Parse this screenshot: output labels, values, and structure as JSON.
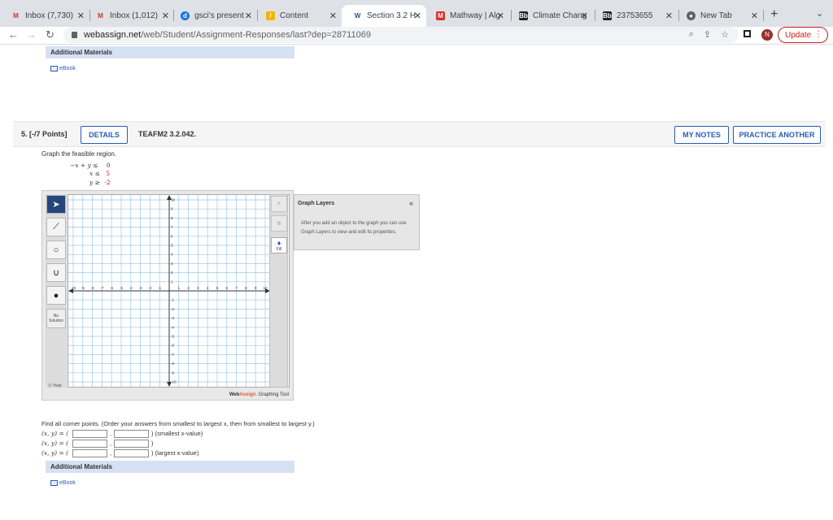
{
  "browser": {
    "tabs": [
      {
        "title": "Inbox (7,730)",
        "icon": "gmail-icon"
      },
      {
        "title": "Inbox (1,012)",
        "icon": "gmail-icon"
      },
      {
        "title": "gsci's present",
        "icon": "gsci-icon"
      },
      {
        "title": "Content",
        "icon": "content-icon"
      },
      {
        "title": "Section 3.2 H",
        "icon": "webassign-icon"
      },
      {
        "title": "Mathway | Alg",
        "icon": "mathway-icon"
      },
      {
        "title": "Climate Chang",
        "icon": "blackboard-icon"
      },
      {
        "title": "23753655",
        "icon": "blackboard-icon"
      },
      {
        "title": "New Tab",
        "icon": "chrome-icon"
      }
    ],
    "url_host": "webassign.net",
    "url_path": "/web/Student/Assignment-Responses/last?dep=28711069",
    "avatar_letter": "N",
    "update_label": "Update"
  },
  "page": {
    "additional_materials": "Additional Materials",
    "ebook_label": "eBook",
    "question": {
      "number": "5.  [-/7 Points]",
      "details_label": "DETAILS",
      "code": "TEAFM2 3.2.042.",
      "my_notes_label": "MY NOTES",
      "practice_label": "PRACTICE ANOTHER",
      "prompt": "Graph the feasible region.",
      "inequalities": [
        {
          "lhs": "−x + y ≤",
          "rhs": "0"
        },
        {
          "lhs": "x ≤",
          "rhs": "5"
        },
        {
          "lhs": "y ≥",
          "rhs": "-2"
        }
      ]
    },
    "graph_tool": {
      "no_solution_label": "No Solution",
      "help_label": "Help",
      "fill_label": "Fill",
      "brand_web": "Web",
      "brand_assign": "Assign",
      "brand_suffix": ". Graphing Tool",
      "x_ticks": [
        "-10",
        "-9",
        "-8",
        "-7",
        "-6",
        "-5",
        "-4",
        "-3",
        "-2",
        "-1",
        "1",
        "2",
        "3",
        "4",
        "5",
        "6",
        "7",
        "8",
        "9",
        "10"
      ],
      "y_ticks": [
        "10",
        "9",
        "8",
        "7",
        "6",
        "5",
        "4",
        "3",
        "2",
        "1",
        "-1",
        "-2",
        "-3",
        "-4",
        "-5",
        "-6",
        "-7",
        "-8",
        "-9",
        "-10"
      ]
    },
    "graph_layers": {
      "title": "Graph Layers",
      "collapse": "«",
      "body": "After you add an object to the graph you can use Graph Layers to view and edit its properties."
    },
    "corner_points": {
      "instructions": "Find all corner points. (Order your answers from smallest to largest x, then from smallest to largest y.)",
      "row_label": "(x, y) = (",
      "rows": [
        {
          "note": ") (smallest x-value)"
        },
        {
          "note": ")"
        },
        {
          "note": ") (largest x-value)"
        }
      ]
    }
  },
  "colors": {
    "accent": "#2a5db0",
    "brand_orange": "#e8572c",
    "tab_bar": "#dee1e6"
  }
}
